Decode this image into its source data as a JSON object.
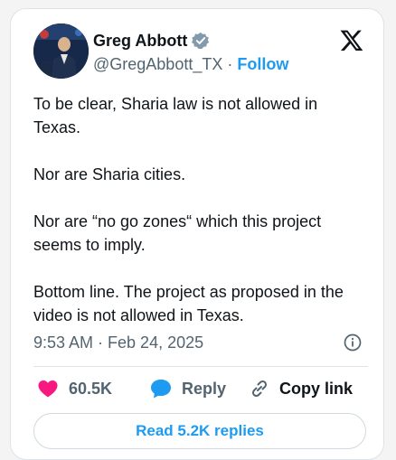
{
  "tweet": {
    "author": {
      "name": "Greg Abbott",
      "handle": "@GregAbbott_TX",
      "follow_label": "Follow",
      "separator": "·"
    },
    "paragraphs": [
      "To be clear, Sharia law is not allowed in Texas.",
      "Nor are Sharia cities.",
      "Nor are “no go zones“ which this project seems to imply.",
      "Bottom line. The project as proposed in the video is not allowed in Texas."
    ],
    "timestamp": "9:53 AM · Feb 24, 2025",
    "likes": "60.5K",
    "reply_label": "Reply",
    "copy_link_label": "Copy link",
    "read_replies_label": "Read 5.2K replies"
  },
  "colors": {
    "accent": "#1d9bf0",
    "like": "#f91880",
    "muted": "#536471",
    "text": "#0f1419"
  },
  "icons": [
    "verified-badge-icon",
    "x-logo-icon",
    "info-icon",
    "heart-icon",
    "reply-bubble-icon",
    "link-icon"
  ]
}
